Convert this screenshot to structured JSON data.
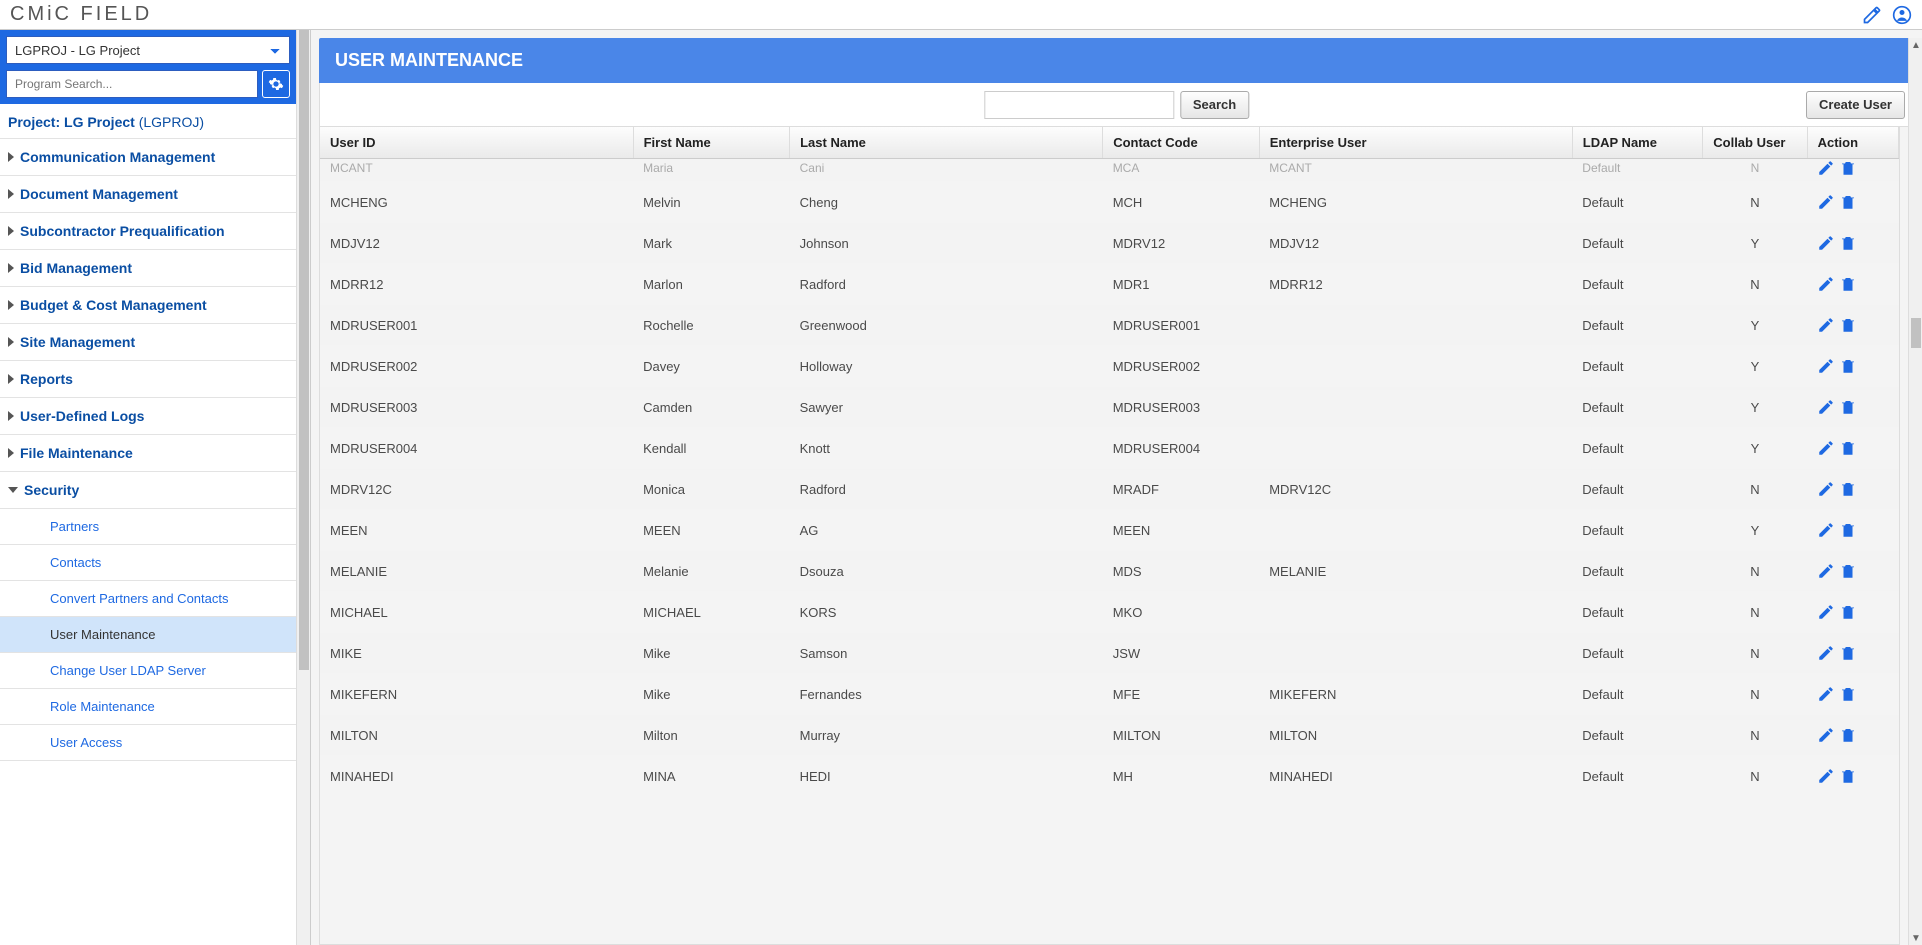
{
  "brand": "CMiC FIELD",
  "project_selector": "LGPROJ - LG Project",
  "search_placeholder": "Program Search...",
  "project_label_prefix": "Project: LG Project",
  "project_label_code": "(LGPROJ)",
  "sidebar": {
    "items": [
      {
        "label": "Communication Management",
        "expanded": false
      },
      {
        "label": "Document Management",
        "expanded": false
      },
      {
        "label": "Subcontractor Prequalification",
        "expanded": false
      },
      {
        "label": "Bid Management",
        "expanded": false
      },
      {
        "label": "Budget & Cost Management",
        "expanded": false
      },
      {
        "label": "Site Management",
        "expanded": false
      },
      {
        "label": "Reports",
        "expanded": false
      },
      {
        "label": "User-Defined Logs",
        "expanded": false
      },
      {
        "label": "File Maintenance",
        "expanded": false
      },
      {
        "label": "Security",
        "expanded": true
      }
    ],
    "subitems": [
      {
        "label": "Partners"
      },
      {
        "label": "Contacts"
      },
      {
        "label": "Convert Partners and Contacts"
      },
      {
        "label": "User Maintenance",
        "active": true
      },
      {
        "label": "Change User LDAP Server"
      },
      {
        "label": "Role Maintenance"
      },
      {
        "label": "User Access"
      }
    ]
  },
  "page_title": "USER MAINTENANCE",
  "buttons": {
    "search": "Search",
    "create_user": "Create User"
  },
  "columns": {
    "user_id": "User ID",
    "first_name": "First Name",
    "last_name": "Last Name",
    "contact_code": "Contact Code",
    "enterprise_user": "Enterprise User",
    "ldap_name": "LDAP Name",
    "collab_user": "Collab User",
    "action": "Action"
  },
  "rows": [
    {
      "partial": true,
      "user_id": "MCANT",
      "first_name": "Maria",
      "last_name": "Cani",
      "contact_code": "MCA",
      "enterprise_user": "MCANT",
      "ldap_name": "Default",
      "collab_user": "N"
    },
    {
      "user_id": "MCHENG",
      "first_name": "Melvin",
      "last_name": "Cheng",
      "contact_code": "MCH",
      "enterprise_user": "MCHENG",
      "ldap_name": "Default",
      "collab_user": "N"
    },
    {
      "user_id": "MDJV12",
      "first_name": "Mark",
      "last_name": "Johnson",
      "contact_code": "MDRV12",
      "enterprise_user": "MDJV12",
      "ldap_name": "Default",
      "collab_user": "Y"
    },
    {
      "user_id": "MDRR12",
      "first_name": "Marlon",
      "last_name": "Radford",
      "contact_code": "MDR1",
      "enterprise_user": "MDRR12",
      "ldap_name": "Default",
      "collab_user": "N"
    },
    {
      "user_id": "MDRUSER001",
      "first_name": "Rochelle",
      "last_name": "Greenwood",
      "contact_code": "MDRUSER001",
      "enterprise_user": "",
      "ldap_name": "Default",
      "collab_user": "Y"
    },
    {
      "user_id": "MDRUSER002",
      "first_name": "Davey",
      "last_name": "Holloway",
      "contact_code": "MDRUSER002",
      "enterprise_user": "",
      "ldap_name": "Default",
      "collab_user": "Y"
    },
    {
      "user_id": "MDRUSER003",
      "first_name": "Camden",
      "last_name": "Sawyer",
      "contact_code": "MDRUSER003",
      "enterprise_user": "",
      "ldap_name": "Default",
      "collab_user": "Y"
    },
    {
      "user_id": "MDRUSER004",
      "first_name": "Kendall",
      "last_name": "Knott",
      "contact_code": "MDRUSER004",
      "enterprise_user": "",
      "ldap_name": "Default",
      "collab_user": "Y"
    },
    {
      "user_id": "MDRV12C",
      "first_name": "Monica",
      "last_name": "Radford",
      "contact_code": "MRADF",
      "enterprise_user": "MDRV12C",
      "ldap_name": "Default",
      "collab_user": "N"
    },
    {
      "user_id": "MEEN",
      "first_name": "MEEN",
      "last_name": "AG",
      "contact_code": "MEEN",
      "enterprise_user": "",
      "ldap_name": "Default",
      "collab_user": "Y"
    },
    {
      "user_id": "MELANIE",
      "first_name": "Melanie",
      "last_name": "Dsouza",
      "contact_code": "MDS",
      "enterprise_user": "MELANIE",
      "ldap_name": "Default",
      "collab_user": "N"
    },
    {
      "user_id": "MICHAEL",
      "first_name": "MICHAEL",
      "last_name": "KORS",
      "contact_code": "MKO",
      "enterprise_user": "",
      "ldap_name": "Default",
      "collab_user": "N"
    },
    {
      "user_id": "MIKE",
      "first_name": "Mike",
      "last_name": "Samson",
      "contact_code": "JSW",
      "enterprise_user": "",
      "ldap_name": "Default",
      "collab_user": "N"
    },
    {
      "user_id": "MIKEFERN",
      "first_name": "Mike",
      "last_name": "Fernandes",
      "contact_code": "MFE",
      "enterprise_user": "MIKEFERN",
      "ldap_name": "Default",
      "collab_user": "N"
    },
    {
      "user_id": "MILTON",
      "first_name": "Milton",
      "last_name": "Murray",
      "contact_code": "MILTON",
      "enterprise_user": "MILTON",
      "ldap_name": "Default",
      "collab_user": "N"
    },
    {
      "partial_bottom": true,
      "user_id": "MINAHEDI",
      "first_name": "MINA",
      "last_name": "HEDI",
      "contact_code": "MH",
      "enterprise_user": "MINAHEDI",
      "ldap_name": "Default",
      "collab_user": "N"
    }
  ]
}
